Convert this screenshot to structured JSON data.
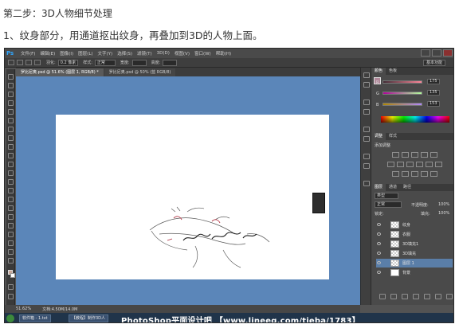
{
  "heading": {
    "step_title": "第二步：3D人物细节处理",
    "step_desc": "1、纹身部分，用通道抠出纹身，再叠加到3D的人物上面。"
  },
  "app": {
    "logo": "Ps",
    "menu": [
      "文件(F)",
      "编辑(E)",
      "图像(I)",
      "图层(L)",
      "文字(Y)",
      "选择(S)",
      "滤镜(T)",
      "3D(D)",
      "视图(V)",
      "窗口(W)",
      "帮助(H)"
    ]
  },
  "options": {
    "feather_label": "羽化:",
    "feather_value": "0.2 像素",
    "style_label": "样式:",
    "style_value": "正常",
    "width_label": "宽度:",
    "height_label": "高度:",
    "workspace": "基本功能"
  },
  "tabs": [
    {
      "label": "罗比尼奥.psd @ 51.6% (图层 1, RGB/8) *",
      "active": true
    },
    {
      "label": "罗比尼奥.psd @ 50% (蓝 RGB/8)",
      "active": false
    }
  ],
  "status": {
    "zoom": "51.62%",
    "doc": "文档:4.50M/14.0M"
  },
  "panels": {
    "color_tabs": [
      "颜色",
      "色板"
    ],
    "rgb": [
      {
        "channel": "R",
        "value": "175",
        "color": "#e05050"
      },
      {
        "channel": "G",
        "value": "135",
        "color": "#50c050"
      },
      {
        "channel": "B",
        "value": "153",
        "color": "#5070e0"
      }
    ],
    "adjust_tabs": [
      "调整",
      "样式"
    ],
    "adjust_title": "添加调整",
    "layer_tabs": [
      "图层",
      "通道",
      "路径"
    ],
    "layer_kind": "类型",
    "blend_mode": "正常",
    "opacity_label": "不透明度:",
    "opacity_value": "100%",
    "lock_label": "锁定:",
    "fill_label": "填充:",
    "fill_value": "100%",
    "layers": [
      "纹身",
      "衣服",
      "3D填充1",
      "3D填充",
      "图层 1",
      "背景"
    ]
  },
  "taskbar": {
    "items": [
      "软件箱 - 1.txt",
      "【教程】制作3D人",
      "罗比尼奥.psd"
    ],
    "watermark": "PhotoShop平面设计吧 【www.lineeg.com/tieba/1783】"
  },
  "colors": {
    "workspace": "#5b86b9",
    "ui_dark": "#3a3a3a",
    "selected_layer": "#5a7ea8"
  }
}
